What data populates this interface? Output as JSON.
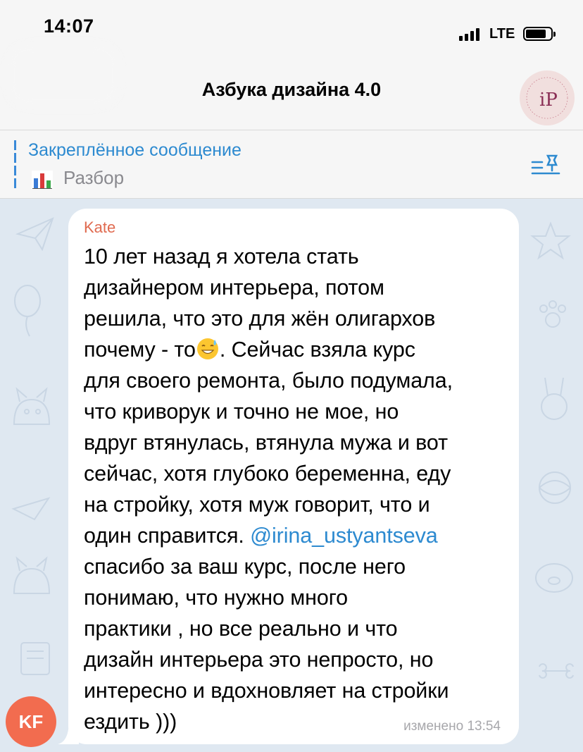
{
  "status_bar": {
    "time": "14:07",
    "network": "LTE"
  },
  "header": {
    "title": "Азбука дизайна 4.0",
    "avatar_initials": "iP"
  },
  "pinned": {
    "title": "Закреплённое сообщение",
    "text": "Разбор",
    "chart_icon": "bar-chart-emoji-icon",
    "list_icon": "pinned-list-icon"
  },
  "message": {
    "sender": "Kate",
    "lines": [
      "10 лет назад я хотела стать",
      "дизайнером интерьера, потом",
      "решила, что это для жён олигархов",
      "почему - то",
      ". Сейчас взяла курс",
      "для своего ремонта, было подумала,",
      "что криворук и точно не мое, но",
      "вдруг втянулась, втянула мужа и вот",
      "сейчас, хотя глубоко беременна, еду",
      "на стройку, хотя муж говорит, что и",
      "один справится. ",
      "@irina_ustyantseva",
      "спасибо за ваш курс, после него",
      "понимаю, что нужно много",
      "практики , но все реально и что",
      "дизайн интерьера это непросто, но",
      "интересно и вдохновляет на стройки",
      "ездить )))"
    ],
    "edited_label": "изменено 13:54",
    "sender_avatar": "KF"
  },
  "colors": {
    "accent": "#2d8ad0",
    "sender_name": "#e06a4f",
    "avatar_bg": "#f26c4f",
    "chat_bg": "#dfe8f1"
  }
}
